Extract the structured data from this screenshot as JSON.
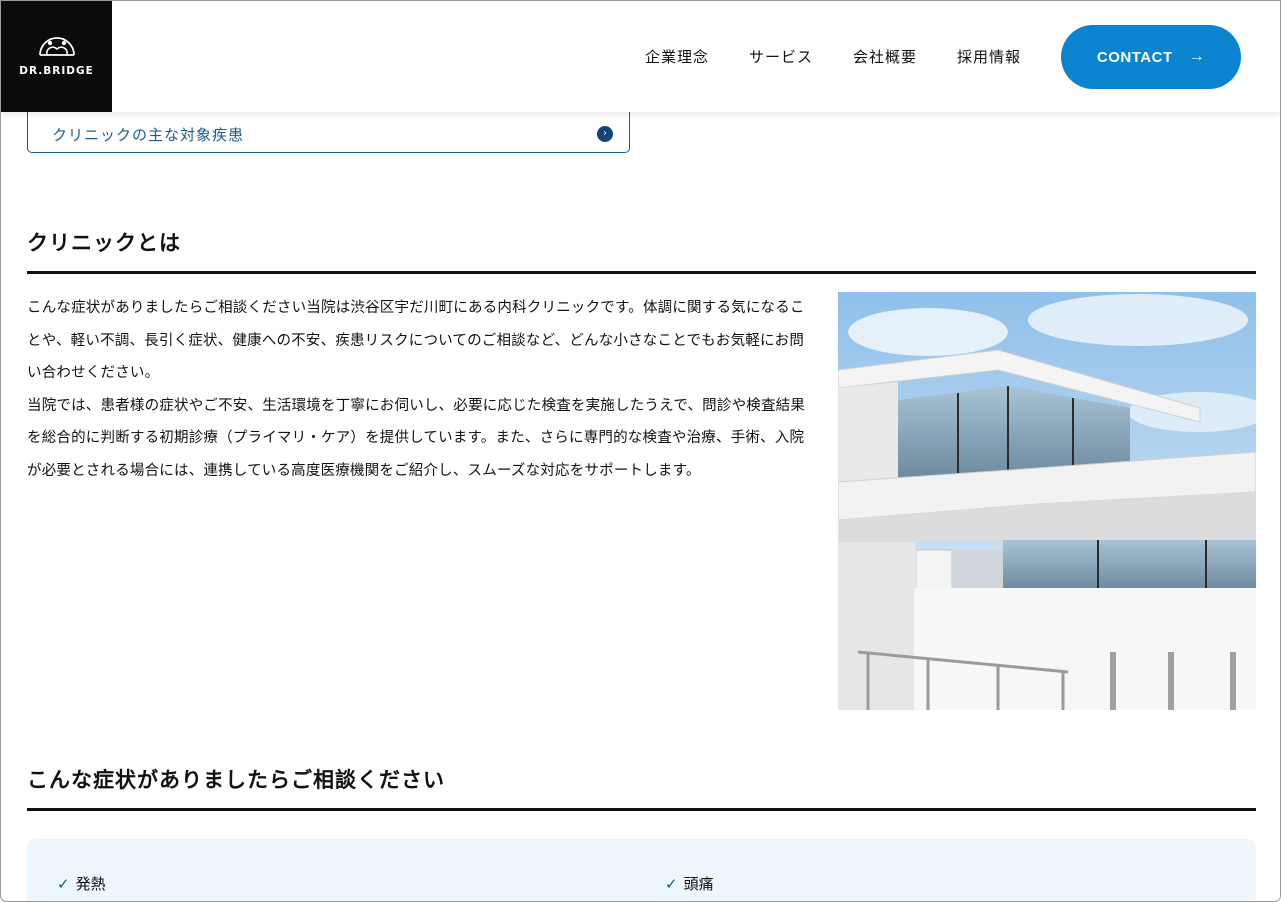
{
  "header": {
    "logo_text": "DR.BRIDGE",
    "nav": [
      {
        "label": "企業理念"
      },
      {
        "label": "サービス"
      },
      {
        "label": "会社概要"
      },
      {
        "label": "採用情報"
      }
    ],
    "contact_label": "CONTACT"
  },
  "anchor": {
    "label": "クリニックの主な対象疾患"
  },
  "section1": {
    "title": "クリニックとは",
    "paragraph1": "こんな症状がありましたらご相談ください当院は渋谷区宇だ川町にある内科クリニックです。体調に関する気になることや、軽い不調、長引く症状、健康への不安、疾患リスクについてのご相談など、どんな小さなことでもお気軽にお問い合わせください。",
    "paragraph2": "当院では、患者様の症状やご不安、生活環境を丁寧にお伺いし、必要に応じた検査を実施したうえで、問診や検査結果を総合的に判断する初期診療（プライマリ・ケア）を提供しています。また、さらに専門的な検査や治療、手術、入院が必要とされる場合には、連携している高度医療機関をご紹介し、スムーズな対応をサポートします。"
  },
  "section2": {
    "title": "こんな症状がありましたらご相談ください",
    "symptoms": [
      {
        "label": "発熱"
      },
      {
        "label": "頭痛"
      }
    ]
  },
  "colors": {
    "accent": "#0a84cf",
    "link": "#1d5a93",
    "symptom_bg": "#eef7fd"
  }
}
